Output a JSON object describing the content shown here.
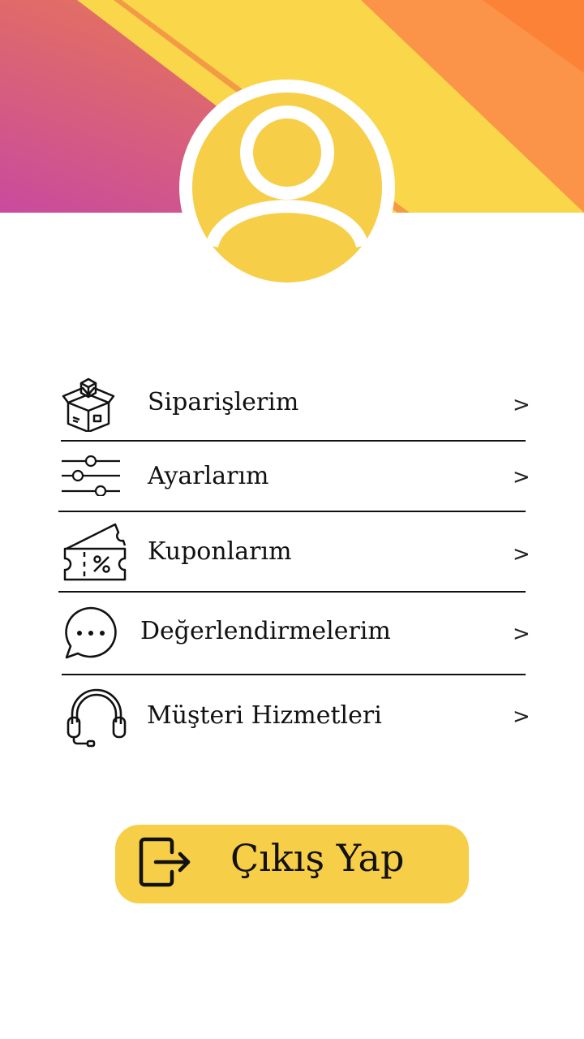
{
  "profile": {
    "avatar_icon": "user-avatar-icon",
    "banner_colors": [
      "#c94a9e",
      "#e87060",
      "#f9d64a",
      "#fb9348",
      "#fb8237"
    ],
    "avatar_color": "#f7ce47"
  },
  "menu": {
    "items": [
      {
        "label": "Siparişlerim",
        "icon": "package-box-icon",
        "chevron": ">"
      },
      {
        "label": "Ayarlarım",
        "icon": "sliders-icon",
        "chevron": ">"
      },
      {
        "label": "Kuponlarım",
        "icon": "coupon-ticket-icon",
        "chevron": ">"
      },
      {
        "label": "Değerlendirmelerim",
        "icon": "chat-bubble-icon",
        "chevron": ">"
      },
      {
        "label": "Müşteri Hizmetleri",
        "icon": "headset-icon",
        "chevron": ">"
      }
    ]
  },
  "logout": {
    "label": "Çıkış Yap",
    "icon": "logout-icon",
    "color": "#f7ce47"
  }
}
